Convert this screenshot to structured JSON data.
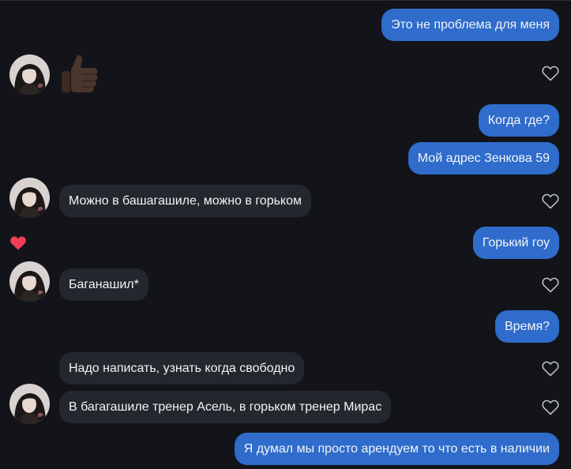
{
  "conversation": {
    "messages": [
      {
        "direction": "outgoing",
        "text": "Это не проблема для меня"
      },
      {
        "direction": "incoming",
        "emoji": "👍🏿"
      },
      {
        "direction": "outgoing",
        "text": "Когда где?"
      },
      {
        "direction": "outgoing",
        "text": "Мой адрес Зенкова 59"
      },
      {
        "direction": "incoming",
        "text": "Можно в башагашиле, можно в горьком"
      },
      {
        "direction": "outgoing",
        "text": "Горький гоу",
        "reaction": "heart"
      },
      {
        "direction": "incoming",
        "text": "Баганашил*"
      },
      {
        "direction": "outgoing",
        "text": "Время?"
      },
      {
        "direction": "incoming",
        "text": "Надо написать, узнать когда свободно"
      },
      {
        "direction": "incoming",
        "text": "В багагашиле тренер Асель, в горьком тренер Мирас"
      },
      {
        "direction": "outgoing",
        "text": "Я думал мы просто арендуем то что есть в наличии"
      }
    ]
  },
  "colors": {
    "background": "#12141a",
    "outgoing_bubble": "#2f6ccb",
    "incoming_bubble": "#24272e",
    "reaction_heart": "#ef3e55",
    "like_outline": "#b8bbc0"
  },
  "icons": {
    "like": "heart-outline-icon",
    "reaction": "heart-filled-icon",
    "thumbs_up": "thumbs-up-emoji"
  }
}
